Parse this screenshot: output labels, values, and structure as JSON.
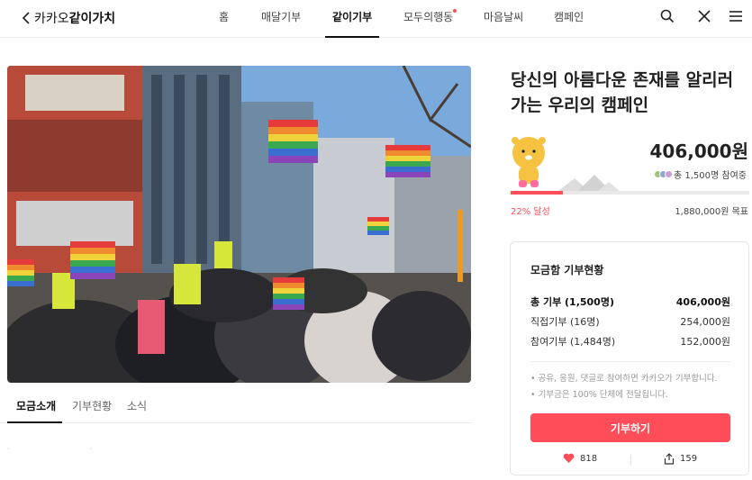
{
  "header": {
    "brand_regular": "카카오",
    "brand_bold": "같이가치",
    "nav": [
      {
        "label": "홈"
      },
      {
        "label": "매달기부"
      },
      {
        "label": "같이기부"
      },
      {
        "label": "모두의행동"
      },
      {
        "label": "마음날씨"
      },
      {
        "label": "캠페인"
      }
    ]
  },
  "campaign": {
    "title": "당신의 아름다운 존재를 알리러 가는 우리의 캠페인",
    "amount": "406,000원",
    "participants": "총 1,500명 참여중",
    "progress_percent": 22,
    "progress_label": "22% 달성",
    "goal": "1,880,000원 목표"
  },
  "subtabs": [
    {
      "label": "모금소개"
    },
    {
      "label": "기부현황"
    },
    {
      "label": "소식"
    }
  ],
  "donation_box": {
    "title": "모금함 기부현황",
    "rows": [
      {
        "label": "총 기부 (1,500명)",
        "value": "406,000원"
      },
      {
        "label": "직접기부 (16명)",
        "value": "254,000원"
      },
      {
        "label": "참여기부 (1,484명)",
        "value": "152,000원"
      }
    ],
    "notes": [
      "• 공유, 응원, 댓글로 참여하면 카카오가 기부합니다.",
      "• 기부금은 100% 단체에 전달됩니다."
    ],
    "donate_label": "기부하기",
    "likes": "818",
    "shares": "159"
  },
  "colors": {
    "accent": "#ff4d5a"
  }
}
